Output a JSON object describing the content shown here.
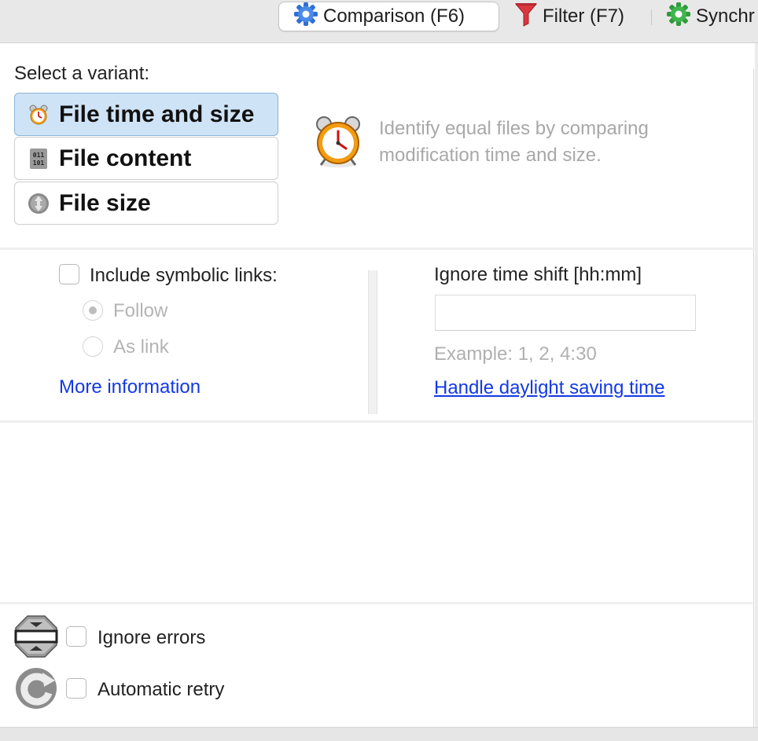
{
  "tabs": [
    {
      "label": "Comparison (F6)",
      "icon": "gear-blue-icon",
      "active": true
    },
    {
      "label": "Filter (F7)",
      "icon": "funnel-red-icon",
      "active": false
    },
    {
      "label": "Synchr",
      "icon": "gear-green-icon",
      "active": false
    }
  ],
  "variant": {
    "heading": "Select a variant:",
    "options": [
      {
        "label": "File time and size",
        "icon": "alarm-clock-icon",
        "selected": true
      },
      {
        "label": "File content",
        "icon": "binary-file-icon",
        "selected": false
      },
      {
        "label": "File size",
        "icon": "size-arrows-icon",
        "selected": false
      }
    ],
    "description": "Identify equal files by comparing modification time and size."
  },
  "symlinks": {
    "label": "Include symbolic links:",
    "checked": false,
    "options": [
      {
        "label": "Follow",
        "selected": true
      },
      {
        "label": "As link",
        "selected": false
      }
    ],
    "more_info": "More information"
  },
  "timeshift": {
    "label": "Ignore time shift [hh:mm]",
    "value": "",
    "example": "Example:  1, 2, 4:30",
    "dst_link": "Handle daylight saving time"
  },
  "errors": {
    "ignore_label": "Ignore errors",
    "retry_label": "Automatic retry"
  },
  "colors": {
    "accent": "#1338e6",
    "selection": "#cfe3f6",
    "disabled": "#b4b4b4"
  }
}
